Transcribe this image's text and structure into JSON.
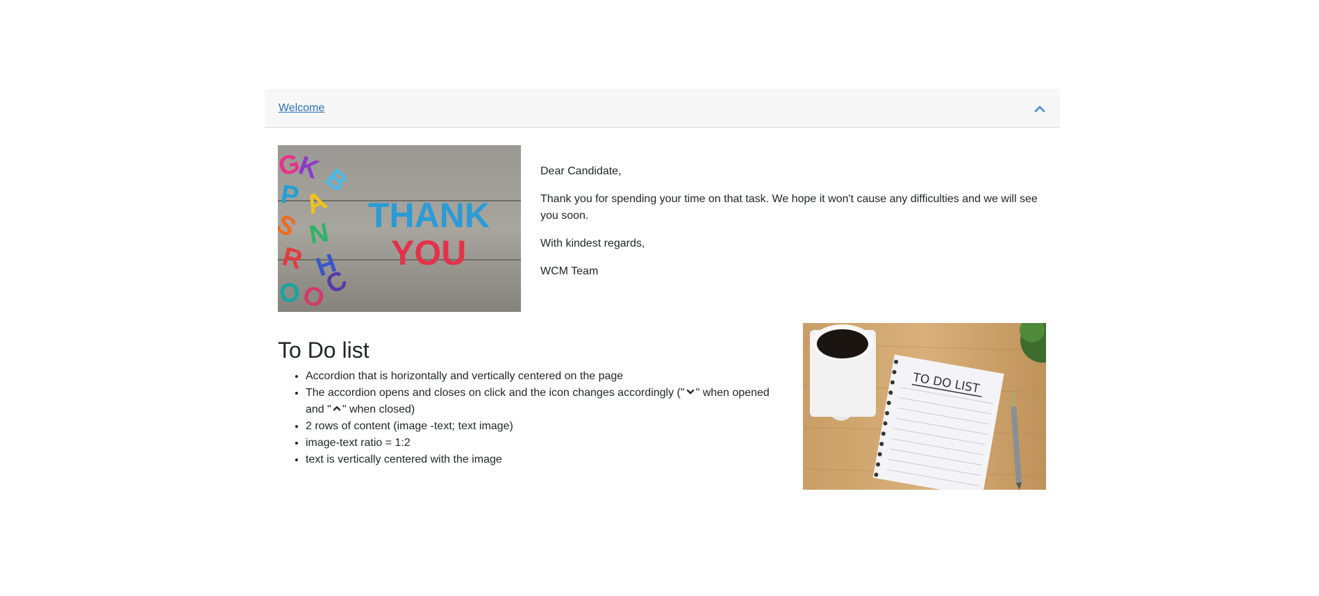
{
  "accordion": {
    "header_label": "Welcome",
    "chevron_icon": "chevron-up-icon"
  },
  "letter": {
    "greeting": "Dear Candidate,",
    "body": "Thank you for spending your time on that task. We hope it won't cause any difficulties and we will see you soon.",
    "closing": "With kindest regards,",
    "signature": "WCM Team"
  },
  "thank_you_image": {
    "line1": "THANK",
    "line2": "YOU"
  },
  "todo": {
    "title": "To Do list",
    "items": [
      "Accordion that is horizontally and vertically centered on the page",
      "The accordion opens and closes on click and the icon changes accordingly (\"",
      "2 rows of content (image -text; text image)",
      "image-text ratio = 1:2",
      "text is vertically centered with the image"
    ],
    "item2_mid": "\" when opened and \"",
    "item2_end": "\" when closed)"
  },
  "todo_image": {
    "notebook_text": "TO DO LIST"
  },
  "colors": {
    "link": "#2a6fb6",
    "header_bg": "#f7f7f7"
  }
}
